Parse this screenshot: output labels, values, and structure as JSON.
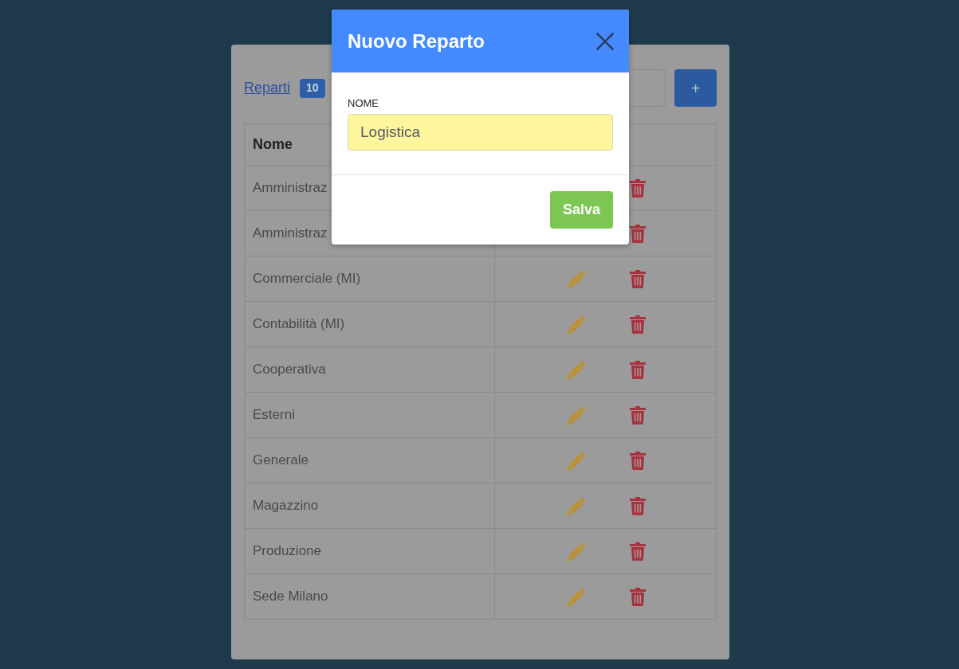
{
  "list_header": {
    "title_link": "Reparti",
    "count_badge": "10",
    "add_button": "+"
  },
  "table": {
    "columns": [
      "Nome"
    ],
    "rows": [
      {
        "name": "Amministraz"
      },
      {
        "name": "Amministraz"
      },
      {
        "name": "Commerciale (MI)"
      },
      {
        "name": "Contabilità (MI)"
      },
      {
        "name": "Cooperativa"
      },
      {
        "name": "Esterni"
      },
      {
        "name": "Generale"
      },
      {
        "name": "Magazzino"
      },
      {
        "name": "Produzione"
      },
      {
        "name": "Sede Milano"
      }
    ]
  },
  "modal": {
    "title": "Nuovo Reparto",
    "field": {
      "label": "NOME",
      "value": "Logistica"
    },
    "buttons": [
      "Salva"
    ]
  }
}
